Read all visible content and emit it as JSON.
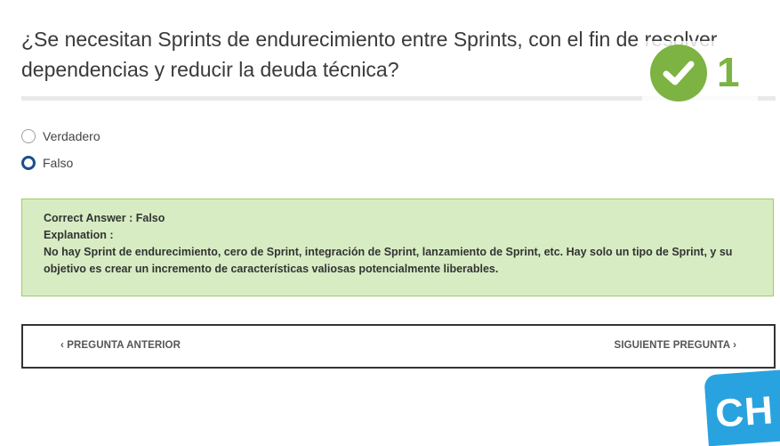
{
  "question": {
    "text": "¿Se necesitan Sprints de endurecimiento entre  Sprints, con el fin de resolver dependencias y reducir la deuda técnica?"
  },
  "badge": {
    "icon": "check-icon",
    "count": "1",
    "color": "#7cb342"
  },
  "options": [
    {
      "label": "Verdadero",
      "selected": false
    },
    {
      "label": "Falso",
      "selected": true
    }
  ],
  "answer": {
    "correct": "Correct Answer : Falso",
    "explanation_label": "Explanation :",
    "explanation": "No hay Sprint de endurecimiento, cero de Sprint, integración de Sprint, lanzamiento de Sprint, etc. Hay solo un tipo de Sprint, y su objetivo es crear un incremento de características valiosas potencialmente liberables.",
    "background": "#d7ecc3"
  },
  "nav": {
    "prev_label": "‹ PREGUNTA ANTERIOR",
    "next_label": "SIGUIENTE PREGUNTA ›"
  },
  "logo": {
    "text": "CH",
    "color": "#29a3e0"
  }
}
